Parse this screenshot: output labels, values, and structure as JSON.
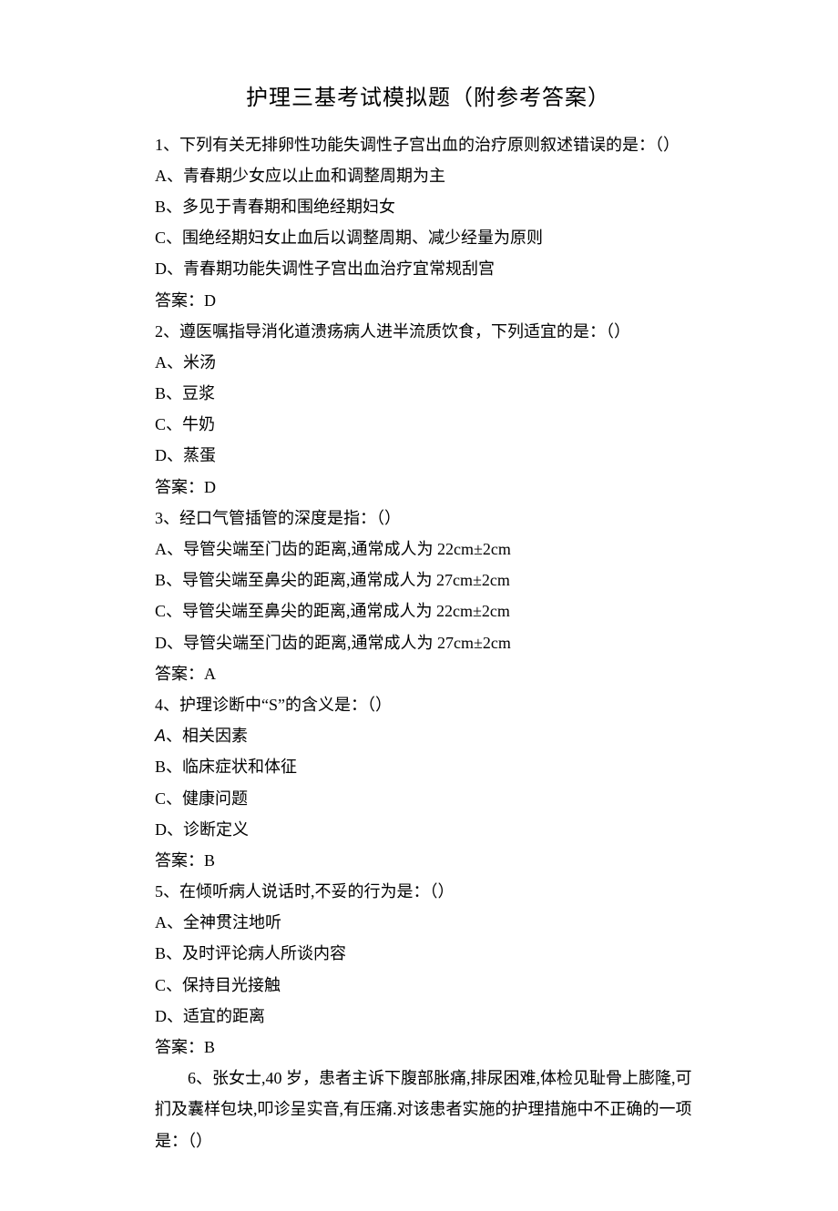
{
  "title": "护理三基考试模拟题（附参考答案）",
  "q1": {
    "stem": "1、下列有关无排卵性功能失调性子宫出血的治疗原则叙述错误的是：（）",
    "A": "A、青春期少女应以止血和调整周期为主",
    "B": "B、多见于青春期和围绝经期妇女",
    "C": "C、围绝经期妇女止血后以调整周期、减少经量为原则",
    "D": "D、青春期功能失调性子宫出血治疗宜常规刮宫",
    "ans": "答案：D"
  },
  "q2": {
    "stem": "2、遵医嘱指导消化道溃疡病人进半流质饮食，下列适宜的是：（）",
    "A": "A、米汤",
    "B": "B、豆浆",
    "C": "C、牛奶",
    "D": "D、蒸蛋",
    "ans": "答案：D"
  },
  "q3": {
    "stem": "3、经口气管插管的深度是指：（）",
    "A": "A、导管尖端至门齿的距离,通常成人为 22cm±2cm",
    "B": "B、导管尖端至鼻尖的距离,通常成人为 27cm±2cm",
    "C": "C、导管尖端至鼻尖的距离,通常成人为 22cm±2cm",
    "D": "D、导管尖端至门齿的距离,通常成人为 27cm±2cm",
    "ans": "答案：A"
  },
  "q4": {
    "stem": "4、护理诊断中“S”的含义是：（）",
    "A_prefix": "A",
    "A_rest": "、相关因素",
    "B": "B、临床症状和体征",
    "C": "C、健康问题",
    "D": "D、诊断定义",
    "ans": "答案：B"
  },
  "q5": {
    "stem": "5、在倾听病人说话时,不妥的行为是：（）",
    "A": "A、全神贯注地听",
    "B": "B、及时评论病人所谈内容",
    "C": "C、保持目光接触",
    "D": "D、适宜的距离",
    "ans": "答案：B"
  },
  "q6": {
    "l1": "6、张女士,40 岁，患者主诉下腹部胀痛,排尿困难,体检见耻骨上膨隆,可",
    "l2": "扪及囊样包块,叩诊呈实音,有压痛.对该患者实施的护理措施中不正确的一项",
    "l3": "是：（）"
  }
}
